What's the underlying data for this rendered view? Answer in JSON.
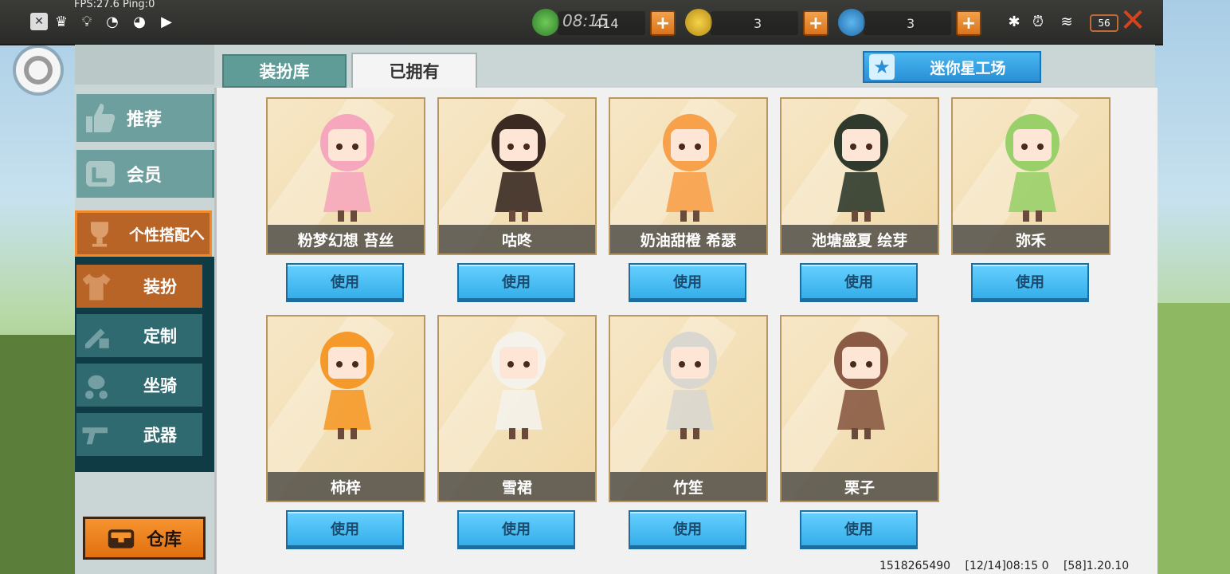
{
  "status_bar": {
    "fps_text": "FPS:27.6  Ping:0",
    "clock": "08:15",
    "currency_1_value": "414",
    "currency_2_value": "3",
    "currency_3_value": "3",
    "battery": "56",
    "coin_1_icon": "green-gem-icon",
    "coin_2_icon": "gold-m-coin-icon",
    "coin_3_icon": "blue-m-coin-icon"
  },
  "tabs": {
    "wardrobe": "装扮库",
    "owned": "已拥有"
  },
  "workshop_button": "迷你星工场",
  "sidebar": {
    "recommend": "推荐",
    "member": "会员",
    "personal_match": "个性搭配へ",
    "costume": "装扮",
    "custom": "定制",
    "mount": "坐骑",
    "weapon": "武器",
    "warehouse": "仓库"
  },
  "cards": [
    {
      "name": "粉梦幻想 苔丝",
      "button": "使用",
      "color": "#f6a7bd"
    },
    {
      "name": "咕咚",
      "button": "使用",
      "color": "#3a2a22"
    },
    {
      "name": "奶油甜橙 希瑟",
      "button": "使用",
      "color": "#f7a14a"
    },
    {
      "name": "池塘盛夏 绘芽",
      "button": "使用",
      "color": "#2f3a2c"
    },
    {
      "name": "弥禾",
      "button": "使用",
      "color": "#9ad06a"
    },
    {
      "name": "柿梓",
      "button": "使用",
      "color": "#f59a2a"
    },
    {
      "name": "雪裙",
      "button": "使用",
      "color": "#f4f2ea"
    },
    {
      "name": "竹笙",
      "button": "使用",
      "color": "#d9d7cf"
    },
    {
      "name": "栗子",
      "button": "使用",
      "color": "#8a5a44"
    }
  ],
  "footer": {
    "uid": "1518265490",
    "time": "[12/14]08:15 0",
    "version": "[58]1.20.10"
  }
}
